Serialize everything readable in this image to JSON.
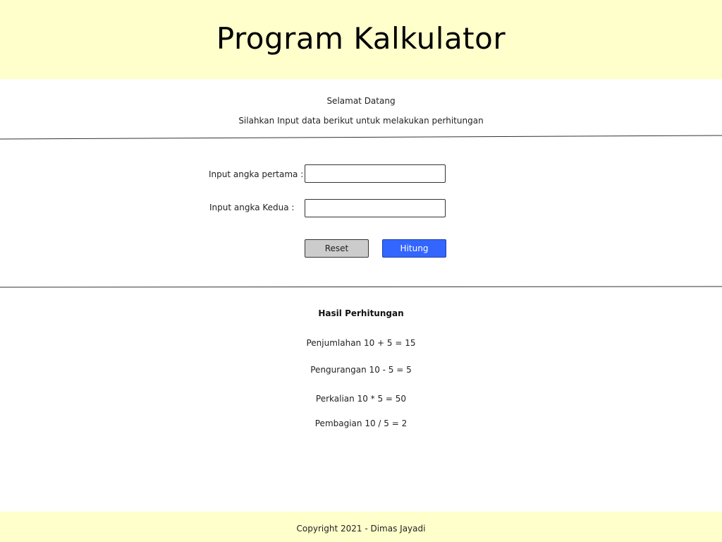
{
  "header": {
    "title": "Program Kalkulator"
  },
  "welcome": {
    "greeting": "Selamat Datang",
    "instruction": "Silahkan Input data berikut untuk melakukan perhitungan"
  },
  "form": {
    "first_label": "Input angka pertama :",
    "first_value": "",
    "second_label": "Input angka Kedua :",
    "second_value": "",
    "reset_label": "Reset",
    "submit_label": "Hitung"
  },
  "results": {
    "title": "Hasil Perhitungan",
    "addition": "Penjumlahan 10 + 5 = 15",
    "subtraction": "Pengurangan 10 - 5 = 5",
    "multiplication": "Perkalian 10 * 5 = 50",
    "division": "Pembagian 10 / 5 = 2"
  },
  "footer": {
    "copyright": "Copyright 2021 - Dimas Jayadi"
  },
  "colors": {
    "header_bg": "#ffffcc",
    "footer_bg": "#ffffcc",
    "primary_button": "#3366ff",
    "secondary_button": "#cccccc"
  }
}
